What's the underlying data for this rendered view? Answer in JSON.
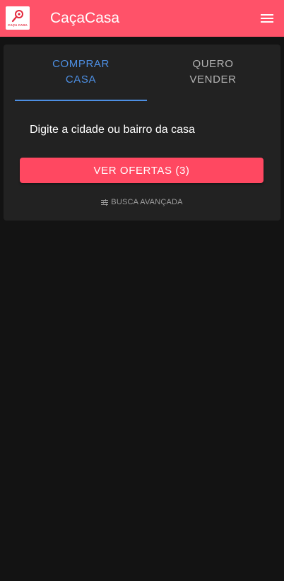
{
  "header": {
    "title": "CaçaCasa",
    "logo_text": "CAÇA CASA",
    "menu_icon": "hamburger-menu-icon",
    "background_color": "#ff5269"
  },
  "tabs": [
    {
      "label": "COMPRAR CASA",
      "active": true
    },
    {
      "label": "QUERO VENDER",
      "active": false
    }
  ],
  "search": {
    "placeholder": "Digite a cidade ou bairro da casa",
    "value": ""
  },
  "actions": {
    "offers_button_label": "VER OFERTAS (3)",
    "advanced_search_label": "BUSCA AVANÇADA",
    "advanced_search_icon": "tune-icon"
  },
  "colors": {
    "accent": "#4d8fe3",
    "brand": "#ff4861",
    "background": "#131313",
    "card": "#222222"
  }
}
